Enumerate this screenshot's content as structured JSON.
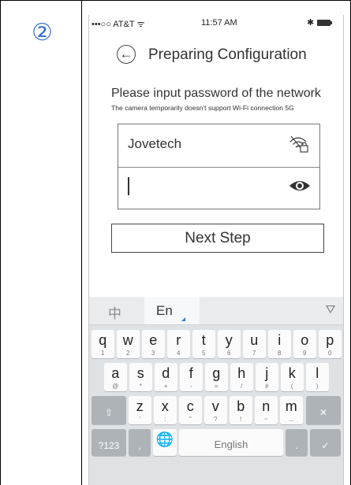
{
  "step": {
    "number": "②"
  },
  "status_bar": {
    "carrier": "•••○○ AT&T",
    "wifi_glyph": "ᯤ",
    "time": "11:57 AM",
    "bluetooth": "✱"
  },
  "header": {
    "title": "Preparing  Configuration",
    "back_icon": "back-arrow-icon"
  },
  "prompt": {
    "main": "Please input password of the network",
    "sub": "The camera temporarily doesn't support Wi-Fi connection 5G"
  },
  "form": {
    "ssid": "Jovetech",
    "ssid_icon": "wifi-lock-icon",
    "password_value": "",
    "password_icon": "eye-icon"
  },
  "next_button": {
    "label": "Next Step"
  },
  "keyboard": {
    "lang_zh": "中",
    "lang_en": "En",
    "row1": [
      {
        "ch": "q",
        "sub": "1"
      },
      {
        "ch": "w",
        "sub": "2"
      },
      {
        "ch": "e",
        "sub": "3"
      },
      {
        "ch": "r",
        "sub": "4"
      },
      {
        "ch": "t",
        "sub": "5"
      },
      {
        "ch": "y",
        "sub": "6"
      },
      {
        "ch": "u",
        "sub": "7"
      },
      {
        "ch": "i",
        "sub": "8"
      },
      {
        "ch": "o",
        "sub": "9"
      },
      {
        "ch": "p",
        "sub": "0"
      }
    ],
    "row2": [
      {
        "ch": "a",
        "sub": "@"
      },
      {
        "ch": "s",
        "sub": "*"
      },
      {
        "ch": "d",
        "sub": "+"
      },
      {
        "ch": "f",
        "sub": "-"
      },
      {
        "ch": "g",
        "sub": "="
      },
      {
        "ch": "h",
        "sub": "/"
      },
      {
        "ch": "j",
        "sub": "#"
      },
      {
        "ch": "k",
        "sub": "("
      },
      {
        "ch": "l",
        "sub": ")"
      }
    ],
    "row3": [
      {
        "ch": "z",
        "sub": "'"
      },
      {
        "ch": "x",
        "sub": ":"
      },
      {
        "ch": "c",
        "sub": "\""
      },
      {
        "ch": "v",
        "sub": "?"
      },
      {
        "ch": "b",
        "sub": "!"
      },
      {
        "ch": "n",
        "sub": "~"
      },
      {
        "ch": "m",
        "sub": "..."
      }
    ],
    "shift_glyph": "⇧",
    "delete_glyph": "✕",
    "symbols_label": "?123",
    "comma": ",",
    "globe_glyph": "🌐",
    "space_label": "English",
    "period": ".",
    "enter_glyph": "✓"
  }
}
